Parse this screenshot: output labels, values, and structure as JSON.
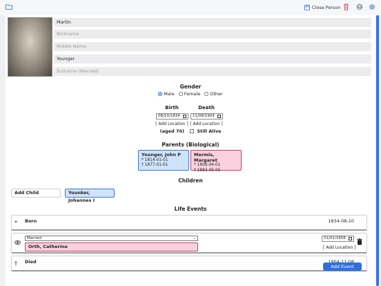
{
  "toolbar": {
    "close_label": "Close Person",
    "icons": [
      "folder-icon",
      "save-icon",
      "trash-icon",
      "avatar-icon",
      "gear-icon"
    ],
    "danger_color": "#e0393e",
    "accent_color": "#2f6fdc"
  },
  "person": {
    "first_name": "Martin",
    "nickname_placeholder": "Nickname",
    "middle_name_placeholder": "Middle Name",
    "last_name": "Younger",
    "surname_married_placeholder": "Surname (Married)"
  },
  "gender": {
    "title": "Gender",
    "options": [
      "Male",
      "Female",
      "Other"
    ],
    "selected": "Male"
  },
  "vitals": {
    "birth_label": "Birth",
    "death_label": "Death",
    "birth_date": "08/10/1834",
    "death_date": "11/08/1904",
    "add_location": "[ Add Location ]",
    "age": "(aged 70)",
    "still_alive_label": "Still Alive"
  },
  "parents": {
    "title": "Parents (Biological)",
    "father": {
      "name": "Younger, John P",
      "born": "* 1814-01-01",
      "died": "† 1877-01-01"
    },
    "mother": {
      "name": "Mermis, Margaret",
      "born": "* 1806-04-01",
      "died": "† 1883-05-05"
    }
  },
  "children": {
    "title": "Children",
    "add_label": "Add Child",
    "items": [
      "Younker, Johannes I"
    ]
  },
  "life_events": {
    "title": "Life Events",
    "born": {
      "icon": "*",
      "label": "Born",
      "date": "1834-08-10"
    },
    "marriage": {
      "type": "Married",
      "spouse": "Orth, Catherine",
      "date": "01/01/1858",
      "add_location": "[ Add Location ]"
    },
    "died": {
      "icon": "†",
      "label": "Died",
      "date": "1904-11-08"
    },
    "add_event_label": "Add Event"
  }
}
